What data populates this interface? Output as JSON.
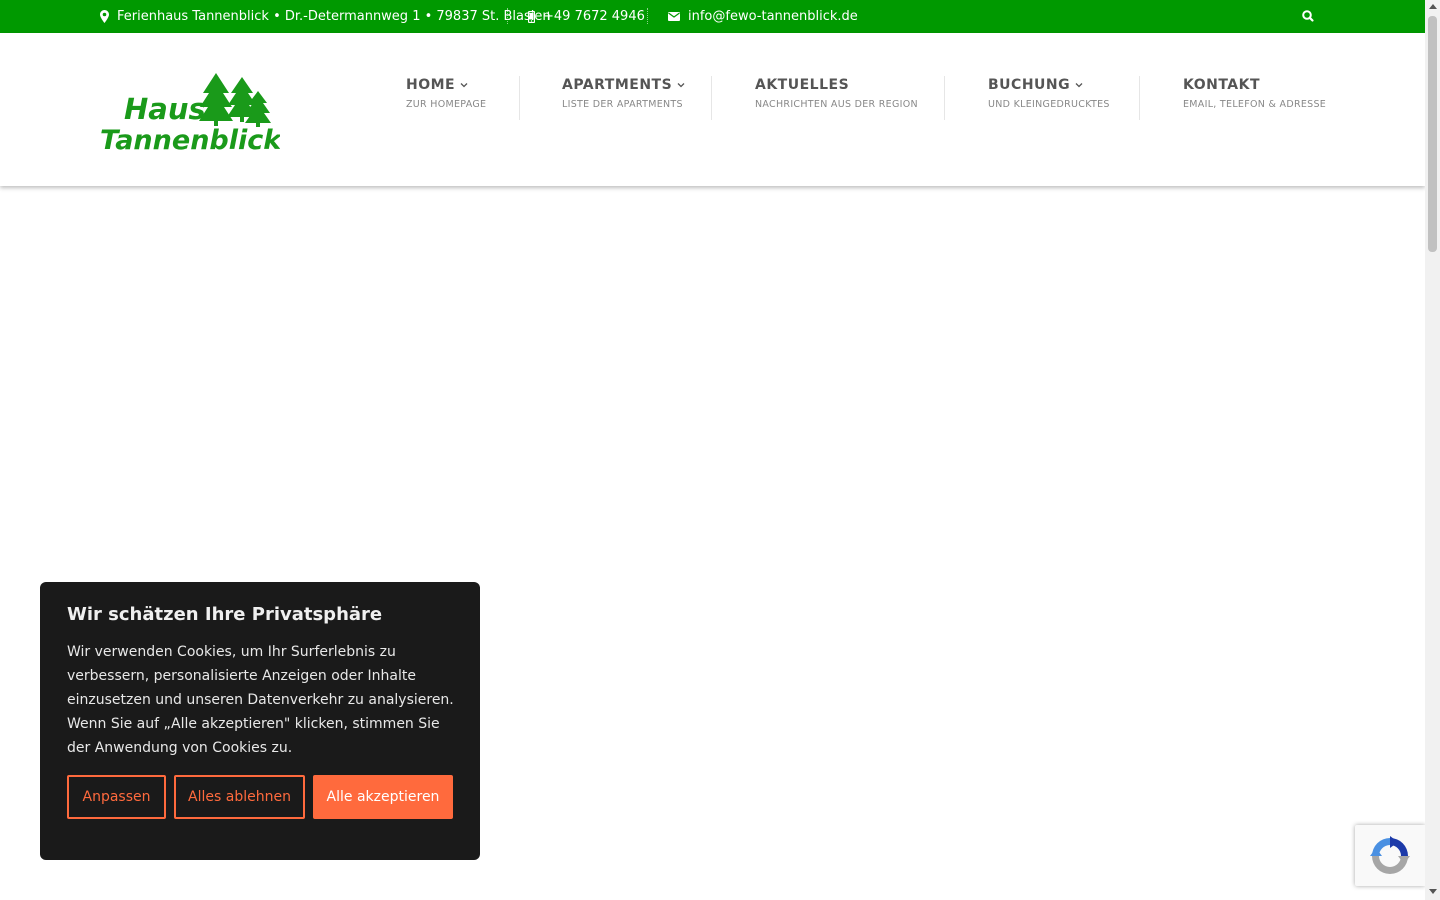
{
  "topbar": {
    "address": "Ferienhaus Tannenblick • Dr.-Determannweg 1 • 79837 St. Blasien",
    "phone": "+49 7672 4946",
    "email": "info@fewo-tannenblick.de",
    "icons": [
      "map-marker-icon",
      "mobile-phone-icon",
      "envelope-icon",
      "search-icon"
    ],
    "background_color": "#009900"
  },
  "logo": {
    "line1": "Haus",
    "line2": "Tannenblick",
    "color": "#1a9a1a"
  },
  "nav": {
    "items": [
      {
        "title": "HOME",
        "subtitle": "ZUR HOMEPAGE",
        "has_dropdown": true
      },
      {
        "title": "APARTMENTS",
        "subtitle": "LISTE DER APARTMENTS",
        "has_dropdown": true
      },
      {
        "title": "AKTUELLES",
        "subtitle": "NACHRICHTEN AUS DER REGION",
        "has_dropdown": false
      },
      {
        "title": "BUCHUNG",
        "subtitle": "UND KLEINGEDRUCKTES",
        "has_dropdown": true
      },
      {
        "title": "KONTAKT",
        "subtitle": "EMAIL, TELEFON & ADRESSE",
        "has_dropdown": false
      }
    ]
  },
  "cookie_banner": {
    "title": "Wir schätzen Ihre Privatsphäre",
    "text": "Wir verwenden Cookies, um Ihr Surferlebnis zu verbessern, personalisierte Anzeigen oder Inhalte einzusetzen und unseren Datenverkehr zu analysieren. Wenn Sie auf „Alle akzeptieren\" klicken, stimmen Sie der Anwendung von Cookies zu.",
    "buttons": {
      "customize": "Anpassen",
      "reject": "Alles ablehnen",
      "accept": "Alle akzeptieren"
    },
    "accent_color": "#ff6a3d",
    "background_color": "#1a1a1a"
  }
}
